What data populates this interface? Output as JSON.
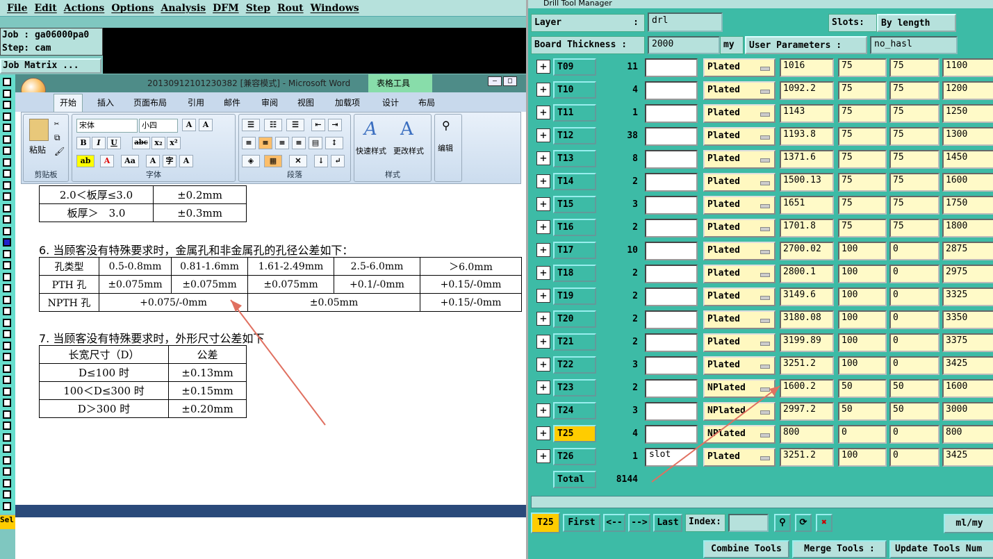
{
  "genesis": {
    "menu": [
      "File",
      "Edit",
      "Actions",
      "Options",
      "Analysis",
      "DFM",
      "Step",
      "Rout",
      "Windows"
    ],
    "job_label": "Job : ga06000pa0",
    "step_label": "Step: cam",
    "job_matrix": "Job Matrix ...",
    "sel_label": "Sel"
  },
  "word": {
    "title": "20130912101230382 [兼容模式] - Microsoft Word",
    "context_tab": "表格工具",
    "tabs": [
      "开始",
      "插入",
      "页面布局",
      "引用",
      "邮件",
      "审阅",
      "视图",
      "加载项",
      "设计",
      "布局"
    ],
    "font_name": "宋体",
    "font_size": "小四",
    "groups": {
      "clipboard": "剪贴板",
      "font": "字体",
      "paragraph": "段落",
      "styles": "样式",
      "editing": "编辑"
    },
    "paste_label": "粘贴",
    "quick_style": "快速样式",
    "change_style": "更改样式",
    "edit_label": "编辑",
    "table1": [
      [
        "2.0＜板厚≤3.0",
        "±0.2mm"
      ],
      [
        "板厚＞　3.0",
        "±0.3mm"
      ]
    ],
    "heading6": "6. 当顾客没有特殊要求时，金属孔和非金属孔的孔径公差如下：",
    "table2_header": [
      "孔类型",
      "0.5-0.8mm",
      "0.81-1.6mm",
      "1.61-2.49mm",
      "2.5-6.0mm",
      "＞6.0mm"
    ],
    "table2_pth": [
      "PTH 孔",
      "±0.075mm",
      "±0.075mm",
      "±0.075mm",
      "+0.1/-0mm",
      "+0.15/-0mm"
    ],
    "table2_npth": [
      "NPTH 孔",
      "+0.075/-0mm",
      "±0.05mm",
      "+0.15/-0mm"
    ],
    "heading7": "7. 当顾客没有特殊要求时，外形尺寸公差如下",
    "table3": [
      [
        "长宽尺寸（D）",
        "公差"
      ],
      [
        "D≤100 时",
        "±0.13mm"
      ],
      [
        "100＜D≤300 时",
        "±0.15mm"
      ],
      [
        "D＞300 时",
        "±0.20mm"
      ]
    ]
  },
  "drill": {
    "title": "Drill Tool Manager",
    "layer_label": "Layer",
    "layer_value": "drl",
    "slots_label": "Slots:",
    "slots_value": "By length",
    "board_thickness_label": "Board Thickness :",
    "board_thickness_value": "2000",
    "unit": "my",
    "user_params_label": "User Parameters :",
    "user_params_value": "no_hasl",
    "rows": [
      {
        "tool": "T09",
        "count": "11",
        "text": "",
        "type": "Plated",
        "a": "1016",
        "b": "75",
        "c": "75",
        "d": "1100"
      },
      {
        "tool": "T10",
        "count": "4",
        "text": "",
        "type": "Plated",
        "a": "1092.2",
        "b": "75",
        "c": "75",
        "d": "1200"
      },
      {
        "tool": "T11",
        "count": "1",
        "text": "",
        "type": "Plated",
        "a": "1143",
        "b": "75",
        "c": "75",
        "d": "1250"
      },
      {
        "tool": "T12",
        "count": "38",
        "text": "",
        "type": "Plated",
        "a": "1193.8",
        "b": "75",
        "c": "75",
        "d": "1300"
      },
      {
        "tool": "T13",
        "count": "8",
        "text": "",
        "type": "Plated",
        "a": "1371.6",
        "b": "75",
        "c": "75",
        "d": "1450"
      },
      {
        "tool": "T14",
        "count": "2",
        "text": "",
        "type": "Plated",
        "a": "1500.13",
        "b": "75",
        "c": "75",
        "d": "1600"
      },
      {
        "tool": "T15",
        "count": "3",
        "text": "",
        "type": "Plated",
        "a": "1651",
        "b": "75",
        "c": "75",
        "d": "1750"
      },
      {
        "tool": "T16",
        "count": "2",
        "text": "",
        "type": "Plated",
        "a": "1701.8",
        "b": "75",
        "c": "75",
        "d": "1800"
      },
      {
        "tool": "T17",
        "count": "10",
        "text": "",
        "type": "Plated",
        "a": "2700.02",
        "b": "100",
        "c": "0",
        "d": "2875"
      },
      {
        "tool": "T18",
        "count": "2",
        "text": "",
        "type": "Plated",
        "a": "2800.1",
        "b": "100",
        "c": "0",
        "d": "2975"
      },
      {
        "tool": "T19",
        "count": "2",
        "text": "",
        "type": "Plated",
        "a": "3149.6",
        "b": "100",
        "c": "0",
        "d": "3325"
      },
      {
        "tool": "T20",
        "count": "2",
        "text": "",
        "type": "Plated",
        "a": "3180.08",
        "b": "100",
        "c": "0",
        "d": "3350"
      },
      {
        "tool": "T21",
        "count": "2",
        "text": "",
        "type": "Plated",
        "a": "3199.89",
        "b": "100",
        "c": "0",
        "d": "3375"
      },
      {
        "tool": "T22",
        "count": "3",
        "text": "",
        "type": "Plated",
        "a": "3251.2",
        "b": "100",
        "c": "0",
        "d": "3425"
      },
      {
        "tool": "T23",
        "count": "2",
        "text": "",
        "type": "NPlated",
        "a": "1600.2",
        "b": "50",
        "c": "50",
        "d": "1600"
      },
      {
        "tool": "T24",
        "count": "3",
        "text": "",
        "type": "NPlated",
        "a": "2997.2",
        "b": "50",
        "c": "50",
        "d": "3000"
      },
      {
        "tool": "T25",
        "count": "4",
        "text": "",
        "type": "NPlated",
        "a": "800",
        "b": "0",
        "c": "0",
        "d": "800"
      },
      {
        "tool": "T26",
        "count": "1",
        "text": "slot",
        "type": "Plated",
        "a": "3251.2",
        "b": "100",
        "c": "0",
        "d": "3425"
      }
    ],
    "selected_tool": "T25",
    "total_label": "Total",
    "total_value": "8144",
    "current_tool": "T25",
    "first": "First",
    "prev": "<--",
    "next": "-->",
    "last": "Last",
    "index_label": "Index:",
    "unit_select": "ml/my",
    "combine": "Combine Tools",
    "merge": "Merge Tools :",
    "update": "Update Tools Num"
  },
  "colors": {
    "accent": "#3dbba6",
    "panel": "#b6e1dc",
    "selected": "#ffcc00",
    "arrow": "#e07060"
  }
}
